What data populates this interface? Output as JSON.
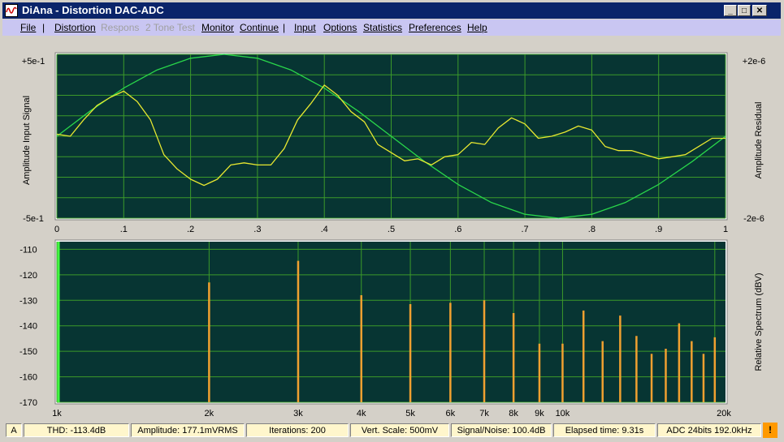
{
  "app": {
    "title": "DiAna - Distortion DAC-ADC",
    "icon": "oscilloscope-icon",
    "window_buttons": {
      "minimize": "_",
      "maximize": "□",
      "close": "✕"
    }
  },
  "menu": [
    {
      "label": "File",
      "enabled": true
    },
    {
      "label": "|",
      "sep": true
    },
    {
      "label": "Distortion",
      "enabled": true
    },
    {
      "label": "Respons",
      "enabled": false
    },
    {
      "label": "2 Tone Test",
      "enabled": false
    },
    {
      "label": "Monitor",
      "enabled": true
    },
    {
      "label": "Continue",
      "enabled": true
    },
    {
      "label": "|",
      "sep": true
    },
    {
      "label": "Input",
      "enabled": true
    },
    {
      "label": "Options",
      "enabled": true
    },
    {
      "label": "Statistics",
      "enabled": true
    },
    {
      "label": "Preferences",
      "enabled": true
    },
    {
      "label": "Help",
      "enabled": true
    }
  ],
  "colors": {
    "plot_bg": "#073533",
    "grid": "#3c9a2a",
    "signal": "#29d64a",
    "residual": "#e8e830",
    "bars": "#f0a030",
    "fundamental": "#40ff40",
    "status_bg": "#fff6cc"
  },
  "chart_data": [
    {
      "type": "line",
      "ylabel_left": "Amplitude Input Signal",
      "ylabel_right": "Amplitude Residual",
      "y_left_ticks": [
        "+5e-1",
        "-5e-1"
      ],
      "y_right_ticks": [
        "+2e-6",
        "-2e-6"
      ],
      "x_tick_labels": [
        "0",
        ".1",
        ".2",
        ".3",
        ".4",
        ".5",
        ".6",
        ".7",
        ".8",
        ".9",
        "1"
      ],
      "xlim": [
        0,
        1
      ],
      "ylim_left": [
        -0.5,
        0.5
      ],
      "ylim_right": [
        -2e-06,
        2e-06
      ],
      "grid": true,
      "series": [
        {
          "name": "Input Signal",
          "axis": "left",
          "x": [
            0,
            0.05,
            0.1,
            0.15,
            0.2,
            0.25,
            0.3,
            0.35,
            0.4,
            0.45,
            0.5,
            0.55,
            0.6,
            0.65,
            0.7,
            0.75,
            0.8,
            0.85,
            0.9,
            0.95,
            1
          ],
          "y": [
            0,
            0.155,
            0.294,
            0.405,
            0.476,
            0.5,
            0.476,
            0.405,
            0.294,
            0.155,
            0,
            -0.155,
            -0.294,
            -0.405,
            -0.476,
            -0.5,
            -0.476,
            -0.405,
            -0.294,
            -0.155,
            0
          ]
        },
        {
          "name": "Residual",
          "axis": "right",
          "x": [
            0,
            0.02,
            0.04,
            0.06,
            0.08,
            0.1,
            0.12,
            0.14,
            0.16,
            0.18,
            0.2,
            0.22,
            0.24,
            0.26,
            0.28,
            0.3,
            0.32,
            0.34,
            0.36,
            0.38,
            0.4,
            0.42,
            0.44,
            0.46,
            0.48,
            0.5,
            0.52,
            0.54,
            0.56,
            0.58,
            0.6,
            0.62,
            0.64,
            0.66,
            0.68,
            0.7,
            0.72,
            0.74,
            0.76,
            0.78,
            0.8,
            0.82,
            0.84,
            0.86,
            0.88,
            0.9,
            0.92,
            0.94,
            0.96,
            0.98,
            1
          ],
          "y": [
            5e-08,
            0.0,
            4e-07,
            7.5e-07,
            9.5e-07,
            1.1e-06,
            8.5e-07,
            4e-07,
            -4.5e-07,
            -8e-07,
            -1.05e-06,
            -1.2e-06,
            -1.05e-06,
            -7e-07,
            -6.5e-07,
            -7e-07,
            -7e-07,
            -3e-07,
            4e-07,
            8e-07,
            1.25e-06,
            1e-06,
            6e-07,
            3.5e-07,
            -2e-07,
            -4e-07,
            -6e-07,
            -5.5e-07,
            -7e-07,
            -5e-07,
            -4.5e-07,
            -1.5e-07,
            -2e-07,
            2e-07,
            4.5e-07,
            3e-07,
            -5e-08,
            0.0,
            1e-07,
            2.5e-07,
            1.5e-07,
            -2.5e-07,
            -3.5e-07,
            -3.5e-07,
            -4.5e-07,
            -5.5e-07,
            -5e-07,
            -4.5e-07,
            -2.5e-07,
            -5e-08,
            -5e-08
          ]
        }
      ]
    },
    {
      "type": "bar",
      "ylabel_right": "Relative Spectrum (dBV)",
      "y_ticks": [
        "-110",
        "-120",
        "-130",
        "-140",
        "-150",
        "-160",
        "-170"
      ],
      "ylim": [
        -170,
        -107
      ],
      "x_scale": "log",
      "xlim_hz": [
        1000,
        21000
      ],
      "x_tick_labels": [
        "1k",
        "2k",
        "3k",
        "4k",
        "5k",
        "6k",
        "7k",
        "8k",
        "9k",
        "10k",
        "20k"
      ],
      "x_tick_hz": [
        1000,
        2000,
        3000,
        4000,
        5000,
        6000,
        7000,
        8000,
        9000,
        10000,
        20000
      ],
      "grid": true,
      "fundamental_hz": 1000,
      "harmonics_hz": [
        2000,
        3000,
        4000,
        5000,
        6000,
        7000,
        8000,
        9000,
        10000,
        11000,
        12000,
        13000,
        14000,
        15000,
        16000,
        17000,
        18000,
        19000,
        20000
      ],
      "harmonics_dbv": [
        -123,
        -114.5,
        -128,
        -131.5,
        -131,
        -130,
        -135,
        -147,
        -147,
        -134,
        -146,
        -136,
        -144,
        -151,
        -149,
        -139,
        -146,
        -151,
        -144.5
      ]
    }
  ],
  "status": {
    "mode": "A",
    "thd": "THD: -113.4dB",
    "amplitude": "Amplitude: 177.1mVRMS",
    "iterations": "Iterations: 200",
    "vert_scale": "Vert. Scale: 500mV",
    "signal_noise": "Signal/Noise:  100.4dB",
    "elapsed": "Elapsed time: 9.31s",
    "adc": "ADC 24bits 192.0kHz",
    "warning": "!"
  }
}
